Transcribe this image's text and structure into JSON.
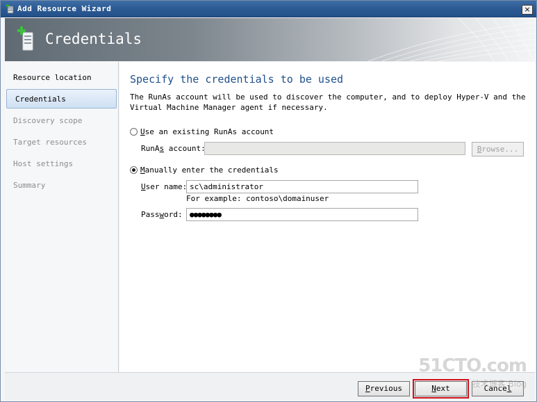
{
  "window": {
    "title": "Add Resource Wizard",
    "close_glyph": "×"
  },
  "banner": {
    "title": "Credentials",
    "icon": "server-add-icon"
  },
  "nav": {
    "items": [
      {
        "label": "Resource location",
        "state": "done"
      },
      {
        "label": "Credentials",
        "state": "active"
      },
      {
        "label": "Discovery scope",
        "state": "pending"
      },
      {
        "label": "Target resources",
        "state": "pending"
      },
      {
        "label": "Host settings",
        "state": "pending"
      },
      {
        "label": "Summary",
        "state": "pending"
      }
    ]
  },
  "content": {
    "heading": "Specify the credentials to be used",
    "description": "The RunAs account will be used to discover the computer, and to deploy Hyper-V and the Virtual Machine Manager agent if necessary.",
    "option_runas": {
      "label_prefix": "",
      "label_u": "U",
      "label_rest": "se an existing RunAs account",
      "checked": false
    },
    "runas_label": {
      "pre": "RunA",
      "u": "s",
      "post": " account:"
    },
    "runas_value": "",
    "browse": {
      "pre": "",
      "u": "B",
      "post": "rowse..."
    },
    "option_manual": {
      "label_u": "M",
      "label_rest": "anually enter the credentials",
      "checked": true
    },
    "username_label": {
      "u": "U",
      "post": "ser name:"
    },
    "username_value": "sc\\administrator",
    "username_hint": "For example: contoso\\domainuser",
    "password_label": {
      "pre": "Pass",
      "u": "w",
      "post": "ord:"
    },
    "password_value": "●●●●●●●●"
  },
  "footer": {
    "previous": {
      "u": "P",
      "post": "revious"
    },
    "next": {
      "u": "N",
      "post": "ext"
    },
    "cancel": {
      "pre": "Cance",
      "u": "l",
      "post": ""
    }
  },
  "watermark": {
    "main": "51CTO.com",
    "sub": "技术博客 Blog"
  },
  "colors": {
    "heading": "#1f4f8a",
    "highlight": "#d0101a",
    "titlebar": "#2c5a93"
  }
}
